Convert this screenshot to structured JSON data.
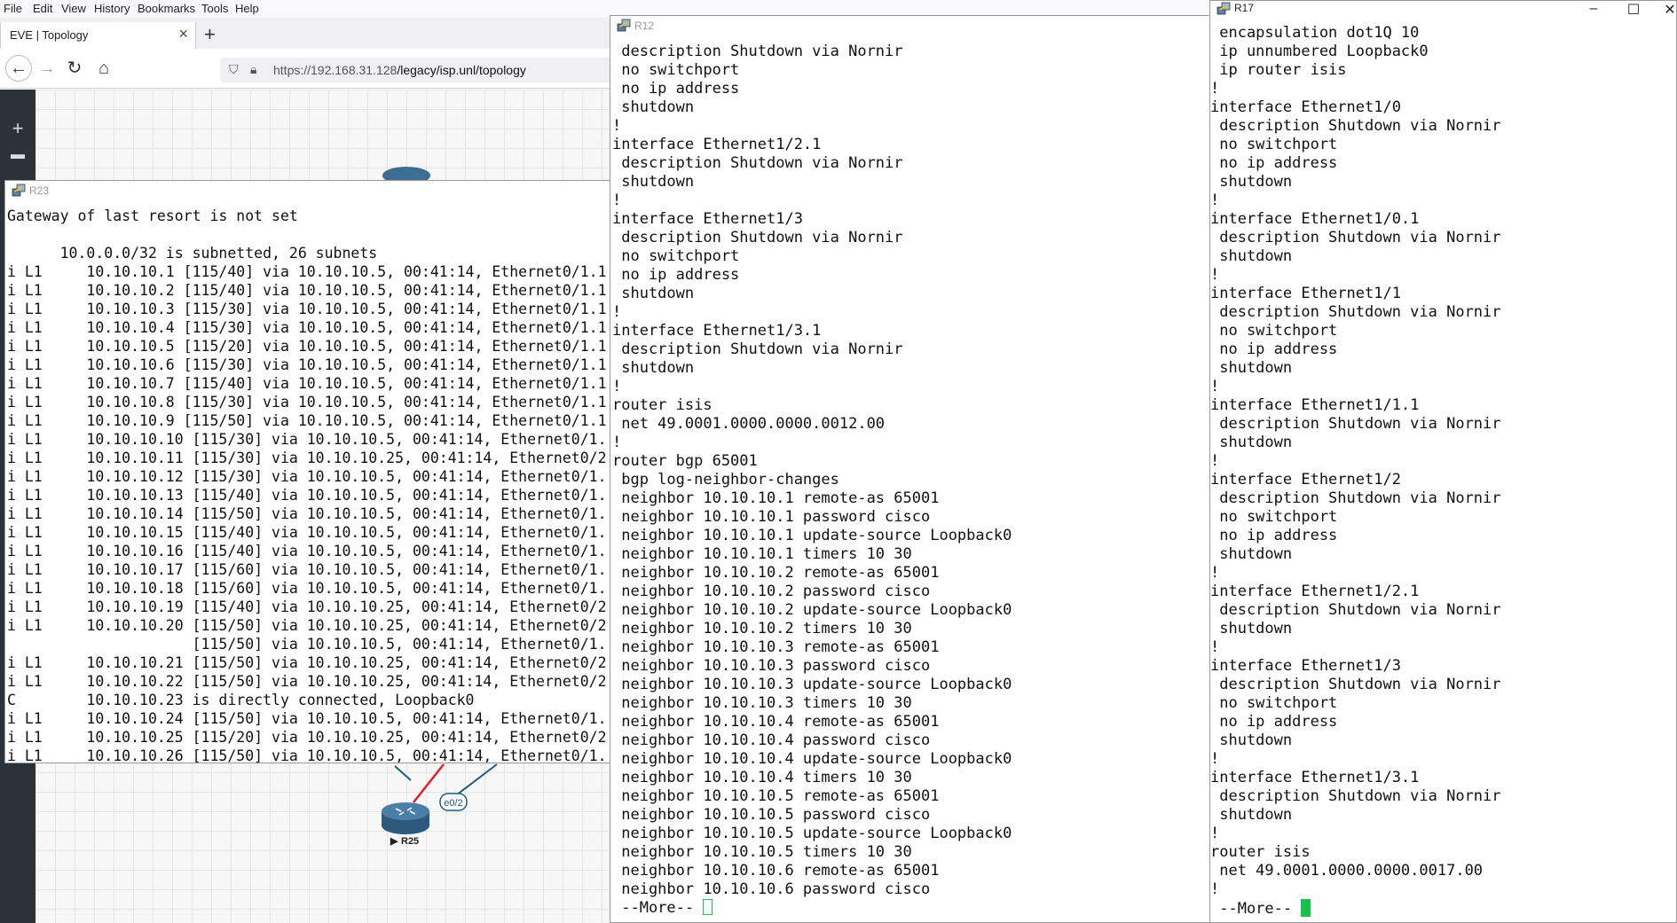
{
  "browser": {
    "menu": [
      "File",
      "Edit",
      "View",
      "History",
      "Bookmarks",
      "Tools",
      "Help"
    ],
    "tab_title": "EVE | Topology",
    "url_host": "https://192.168.31.128",
    "url_path": "/legacy/isp.unl/topology"
  },
  "topology": {
    "node_label": "R25",
    "link_label": "e0/2"
  },
  "windows": {
    "r23": {
      "title": "R23",
      "lines": [
        "Gateway of last resort is not set",
        "",
        "      10.0.0.0/32 is subnetted, 26 subnets",
        "i L1     10.10.10.1 [115/40] via 10.10.10.5, 00:41:14, Ethernet0/1.1",
        "i L1     10.10.10.2 [115/40] via 10.10.10.5, 00:41:14, Ethernet0/1.1",
        "i L1     10.10.10.3 [115/30] via 10.10.10.5, 00:41:14, Ethernet0/1.1",
        "i L1     10.10.10.4 [115/30] via 10.10.10.5, 00:41:14, Ethernet0/1.1",
        "i L1     10.10.10.5 [115/20] via 10.10.10.5, 00:41:14, Ethernet0/1.1",
        "i L1     10.10.10.6 [115/30] via 10.10.10.5, 00:41:14, Ethernet0/1.1",
        "i L1     10.10.10.7 [115/40] via 10.10.10.5, 00:41:14, Ethernet0/1.1",
        "i L1     10.10.10.8 [115/30] via 10.10.10.5, 00:41:14, Ethernet0/1.1",
        "i L1     10.10.10.9 [115/50] via 10.10.10.5, 00:41:14, Ethernet0/1.1",
        "i L1     10.10.10.10 [115/30] via 10.10.10.5, 00:41:14, Ethernet0/1.",
        "i L1     10.10.10.11 [115/30] via 10.10.10.25, 00:41:14, Ethernet0/2",
        "i L1     10.10.10.12 [115/30] via 10.10.10.5, 00:41:14, Ethernet0/1.",
        "i L1     10.10.10.13 [115/40] via 10.10.10.5, 00:41:14, Ethernet0/1.",
        "i L1     10.10.10.14 [115/50] via 10.10.10.5, 00:41:14, Ethernet0/1.",
        "i L1     10.10.10.15 [115/40] via 10.10.10.5, 00:41:14, Ethernet0/1.",
        "i L1     10.10.10.16 [115/40] via 10.10.10.5, 00:41:14, Ethernet0/1.",
        "i L1     10.10.10.17 [115/60] via 10.10.10.5, 00:41:14, Ethernet0/1.",
        "i L1     10.10.10.18 [115/60] via 10.10.10.5, 00:41:14, Ethernet0/1.",
        "i L1     10.10.10.19 [115/40] via 10.10.10.25, 00:41:14, Ethernet0/2",
        "i L1     10.10.10.20 [115/50] via 10.10.10.25, 00:41:14, Ethernet0/2",
        "                     [115/50] via 10.10.10.5, 00:41:14, Ethernet0/1.",
        "i L1     10.10.10.21 [115/50] via 10.10.10.25, 00:41:14, Ethernet0/2",
        "i L1     10.10.10.22 [115/50] via 10.10.10.25, 00:41:14, Ethernet0/2",
        "C        10.10.10.23 is directly connected, Loopback0",
        "i L1     10.10.10.24 [115/50] via 10.10.10.5, 00:41:14, Ethernet0/1.",
        "i L1     10.10.10.25 [115/20] via 10.10.10.25, 00:41:14, Ethernet0/2",
        "i L1     10.10.10.26 [115/50] via 10.10.10.5, 00:41:14, Ethernet0/1."
      ]
    },
    "r12": {
      "title": "R12",
      "lines": [
        " description Shutdown via Nornir",
        " no switchport",
        " no ip address",
        " shutdown",
        "!",
        "interface Ethernet1/2.1",
        " description Shutdown via Nornir",
        " shutdown",
        "!",
        "interface Ethernet1/3",
        " description Shutdown via Nornir",
        " no switchport",
        " no ip address",
        " shutdown",
        "!",
        "interface Ethernet1/3.1",
        " description Shutdown via Nornir",
        " shutdown",
        "!",
        "router isis",
        " net 49.0001.0000.0000.0012.00",
        "!",
        "router bgp 65001",
        " bgp log-neighbor-changes",
        " neighbor 10.10.10.1 remote-as 65001",
        " neighbor 10.10.10.1 password cisco",
        " neighbor 10.10.10.1 update-source Loopback0",
        " neighbor 10.10.10.1 timers 10 30",
        " neighbor 10.10.10.2 remote-as 65001",
        " neighbor 10.10.10.2 password cisco",
        " neighbor 10.10.10.2 update-source Loopback0",
        " neighbor 10.10.10.2 timers 10 30",
        " neighbor 10.10.10.3 remote-as 65001",
        " neighbor 10.10.10.3 password cisco",
        " neighbor 10.10.10.3 update-source Loopback0",
        " neighbor 10.10.10.3 timers 10 30",
        " neighbor 10.10.10.4 remote-as 65001",
        " neighbor 10.10.10.4 password cisco",
        " neighbor 10.10.10.4 update-source Loopback0",
        " neighbor 10.10.10.4 timers 10 30",
        " neighbor 10.10.10.5 remote-as 65001",
        " neighbor 10.10.10.5 password cisco",
        " neighbor 10.10.10.5 update-source Loopback0",
        " neighbor 10.10.10.5 timers 10 30",
        " neighbor 10.10.10.6 remote-as 65001",
        " neighbor 10.10.10.6 password cisco"
      ],
      "prompt": " --More-- "
    },
    "r17": {
      "title": "R17",
      "lines": [
        " encapsulation dot1Q 10",
        " ip unnumbered Loopback0",
        " ip router isis",
        "!",
        "interface Ethernet1/0",
        " description Shutdown via Nornir",
        " no switchport",
        " no ip address",
        " shutdown",
        "!",
        "interface Ethernet1/0.1",
        " description Shutdown via Nornir",
        " shutdown",
        "!",
        "interface Ethernet1/1",
        " description Shutdown via Nornir",
        " no switchport",
        " no ip address",
        " shutdown",
        "!",
        "interface Ethernet1/1.1",
        " description Shutdown via Nornir",
        " shutdown",
        "!",
        "interface Ethernet1/2",
        " description Shutdown via Nornir",
        " no switchport",
        " no ip address",
        " shutdown",
        "!",
        "interface Ethernet1/2.1",
        " description Shutdown via Nornir",
        " shutdown",
        "!",
        "interface Ethernet1/3",
        " description Shutdown via Nornir",
        " no switchport",
        " no ip address",
        " shutdown",
        "!",
        "interface Ethernet1/3.1",
        " description Shutdown via Nornir",
        " shutdown",
        "!",
        "router isis",
        " net 49.0001.0000.0000.0017.00",
        "!"
      ],
      "prompt": " --More-- "
    }
  },
  "colors": {
    "cursor": "#17c24a",
    "link_red": "#e0202a",
    "link_blue": "#1f5a82",
    "router_body": "#3d6e92"
  },
  "icons": {
    "back": "arrow-left-icon",
    "forward": "arrow-right-icon",
    "reload": "reload-icon",
    "home": "home-icon",
    "shield": "shield-icon",
    "lock": "lock-icon",
    "add": "plus-icon",
    "terminal": "putty-icon"
  }
}
